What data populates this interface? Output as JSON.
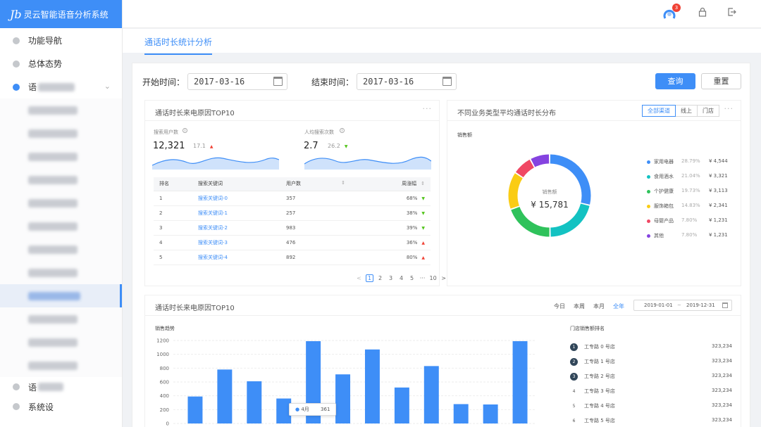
{
  "app": {
    "title": "灵云智能语音分析系统",
    "logo_mark": "Jb"
  },
  "sidebar": {
    "items": [
      {
        "label": "功能导航"
      },
      {
        "label": "总体态势"
      },
      {
        "label": "语"
      }
    ],
    "bottom_items": [
      {
        "label": "语"
      },
      {
        "label": "系统设"
      }
    ]
  },
  "topbar": {
    "notification_count": "3"
  },
  "tabs": [
    {
      "label": "通话时长统计分析"
    }
  ],
  "filters": {
    "start_label": "开始时间：",
    "start_value": "2017-03-16",
    "end_label": "结束时间：",
    "end_value": "2017-03-16",
    "query_label": "查询",
    "reset_label": "重置"
  },
  "panel_top_left": {
    "title": "通话时长来电原因TOP10",
    "more": "···",
    "stat1": {
      "label": "搜索用户数",
      "value": "12,321",
      "delta": "17.1"
    },
    "stat2": {
      "label": "人均搜索次数",
      "value": "2.7",
      "delta": "26.2"
    },
    "table": {
      "headers": [
        "排名",
        "搜索关键词",
        "用户数",
        "周涨幅"
      ],
      "rows": [
        {
          "rank": "1",
          "keyword": "搜索关键词-0",
          "users": "357",
          "change": "68%",
          "trend": "down"
        },
        {
          "rank": "2",
          "keyword": "搜索关键词-1",
          "users": "257",
          "change": "38%",
          "trend": "down"
        },
        {
          "rank": "3",
          "keyword": "搜索关键词-2",
          "users": "983",
          "change": "39%",
          "trend": "down"
        },
        {
          "rank": "4",
          "keyword": "搜索关键词-3",
          "users": "476",
          "change": "36%",
          "trend": "up"
        },
        {
          "rank": "5",
          "keyword": "搜索关键词-4",
          "users": "892",
          "change": "80%",
          "trend": "up"
        }
      ]
    },
    "pager": {
      "prev": "<",
      "pages": [
        "1",
        "2",
        "3",
        "4",
        "5"
      ],
      "ellipsis": "···",
      "last": "10",
      "next": ">",
      "current": "1"
    }
  },
  "panel_top_right": {
    "title": "不同业务类型平均通话时长分布",
    "more": "···",
    "segments": [
      "全部渠道",
      "线上",
      "门店"
    ],
    "active_segment": "全部渠道",
    "subtitle": "销售额",
    "donut_label": "销售额",
    "donut_total": "¥ 15,781"
  },
  "panel_bottom": {
    "title": "通话时长来电原因TOP10",
    "range_tabs": [
      "今日",
      "本周",
      "本月",
      "全年"
    ],
    "active_range": "全年",
    "range_start": "2019-01-01",
    "range_sep": "~",
    "range_end": "2019-12-31",
    "chart_subtitle": "销售趋势",
    "tooltip": {
      "label": "4月",
      "value": "361"
    },
    "ranking_title": "门店销售额排名",
    "ranking": [
      {
        "rank": "1",
        "name": "工专路 0 号店",
        "value": "323,234"
      },
      {
        "rank": "2",
        "name": "工专路 1 号店",
        "value": "323,234"
      },
      {
        "rank": "3",
        "name": "工专路 2 号店",
        "value": "323,234"
      },
      {
        "rank": "4",
        "name": "工专路 3 号店",
        "value": "323,234"
      },
      {
        "rank": "5",
        "name": "工专路 4 号店",
        "value": "323,234"
      },
      {
        "rank": "6",
        "name": "工专路 5 号店",
        "value": "323,234"
      }
    ]
  },
  "chart_data": [
    {
      "type": "pie",
      "title": "销售额",
      "center_value": "¥ 15,781",
      "slices": [
        {
          "name": "家用电器",
          "percent": 28.79,
          "percent_label": "28.79%",
          "value_label": "¥ 4,544",
          "color": "#3e8ef7"
        },
        {
          "name": "食用酒水",
          "percent": 21.04,
          "percent_label": "21.04%",
          "value_label": "¥ 3,321",
          "color": "#13c2c2"
        },
        {
          "name": "个护健康",
          "percent": 19.73,
          "percent_label": "19.73%",
          "value_label": "¥ 3,113",
          "color": "#2fc25b"
        },
        {
          "name": "服饰箱包",
          "percent": 14.83,
          "percent_label": "14.83%",
          "value_label": "¥ 2,341",
          "color": "#facc14"
        },
        {
          "name": "母婴产品",
          "percent": 7.8,
          "percent_label": "7.80%",
          "value_label": "¥ 1,231",
          "color": "#f04864"
        },
        {
          "name": "其他",
          "percent": 7.8,
          "percent_label": "7.80%",
          "value_label": "¥ 1,231",
          "color": "#8543e0"
        }
      ]
    },
    {
      "type": "bar",
      "title": "销售趋势",
      "values": [
        390,
        780,
        610,
        361,
        1190,
        710,
        1070,
        520,
        830,
        280,
        275,
        1190
      ],
      "ylim": [
        0,
        1200
      ],
      "yticks": [
        0,
        200,
        400,
        600,
        800,
        1000,
        1200
      ],
      "color": "#3e8ef7",
      "grid": true
    }
  ],
  "colors": {
    "accent": "#3e8ef7",
    "up": "#f04134",
    "down": "#52c41a"
  }
}
